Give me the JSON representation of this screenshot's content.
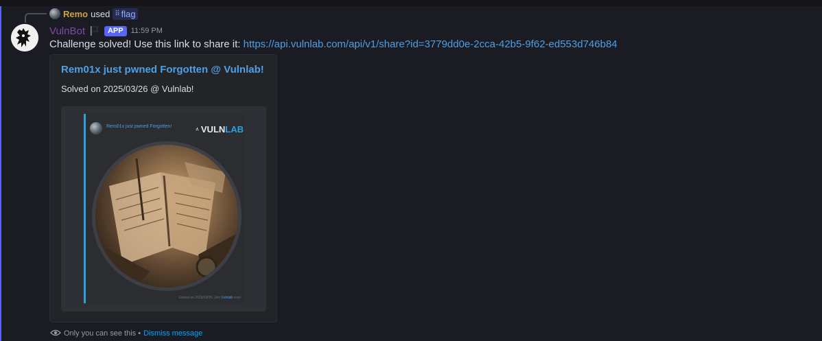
{
  "reply": {
    "user": "Remo",
    "used_text": "used",
    "command": "flag"
  },
  "message": {
    "username": "VulnBot",
    "badge": "APP",
    "timestamp": "11:59 PM",
    "text": "Challenge solved! Use this link to share it: ",
    "link": "https://api.vulnlab.com/api/v1/share?id=3779dd0e-2cca-42b5-9f62-ed553d746b84"
  },
  "embed": {
    "title": "Rem01x just pwned Forgotten @ Vulnlab!",
    "description": "Solved on 2025/03/26 @ Vulnlab!",
    "image": {
      "card_title": "Rem01x just pwned Forgotten!",
      "logo_prefix": "VULN",
      "logo_suffix": "LAB",
      "footer_prefix": "Solved on 2025/03/26. Join ",
      "footer_link": "Vulnlab",
      "footer_suffix": " now!"
    }
  },
  "ephemeral": {
    "notice": "Only you can see this •",
    "dismiss": "Dismiss message"
  },
  "colors": {
    "accent": "#5865f2",
    "link": "#4e9fe4",
    "username": "#7c4ba6",
    "reply_user": "#c9a63a"
  }
}
